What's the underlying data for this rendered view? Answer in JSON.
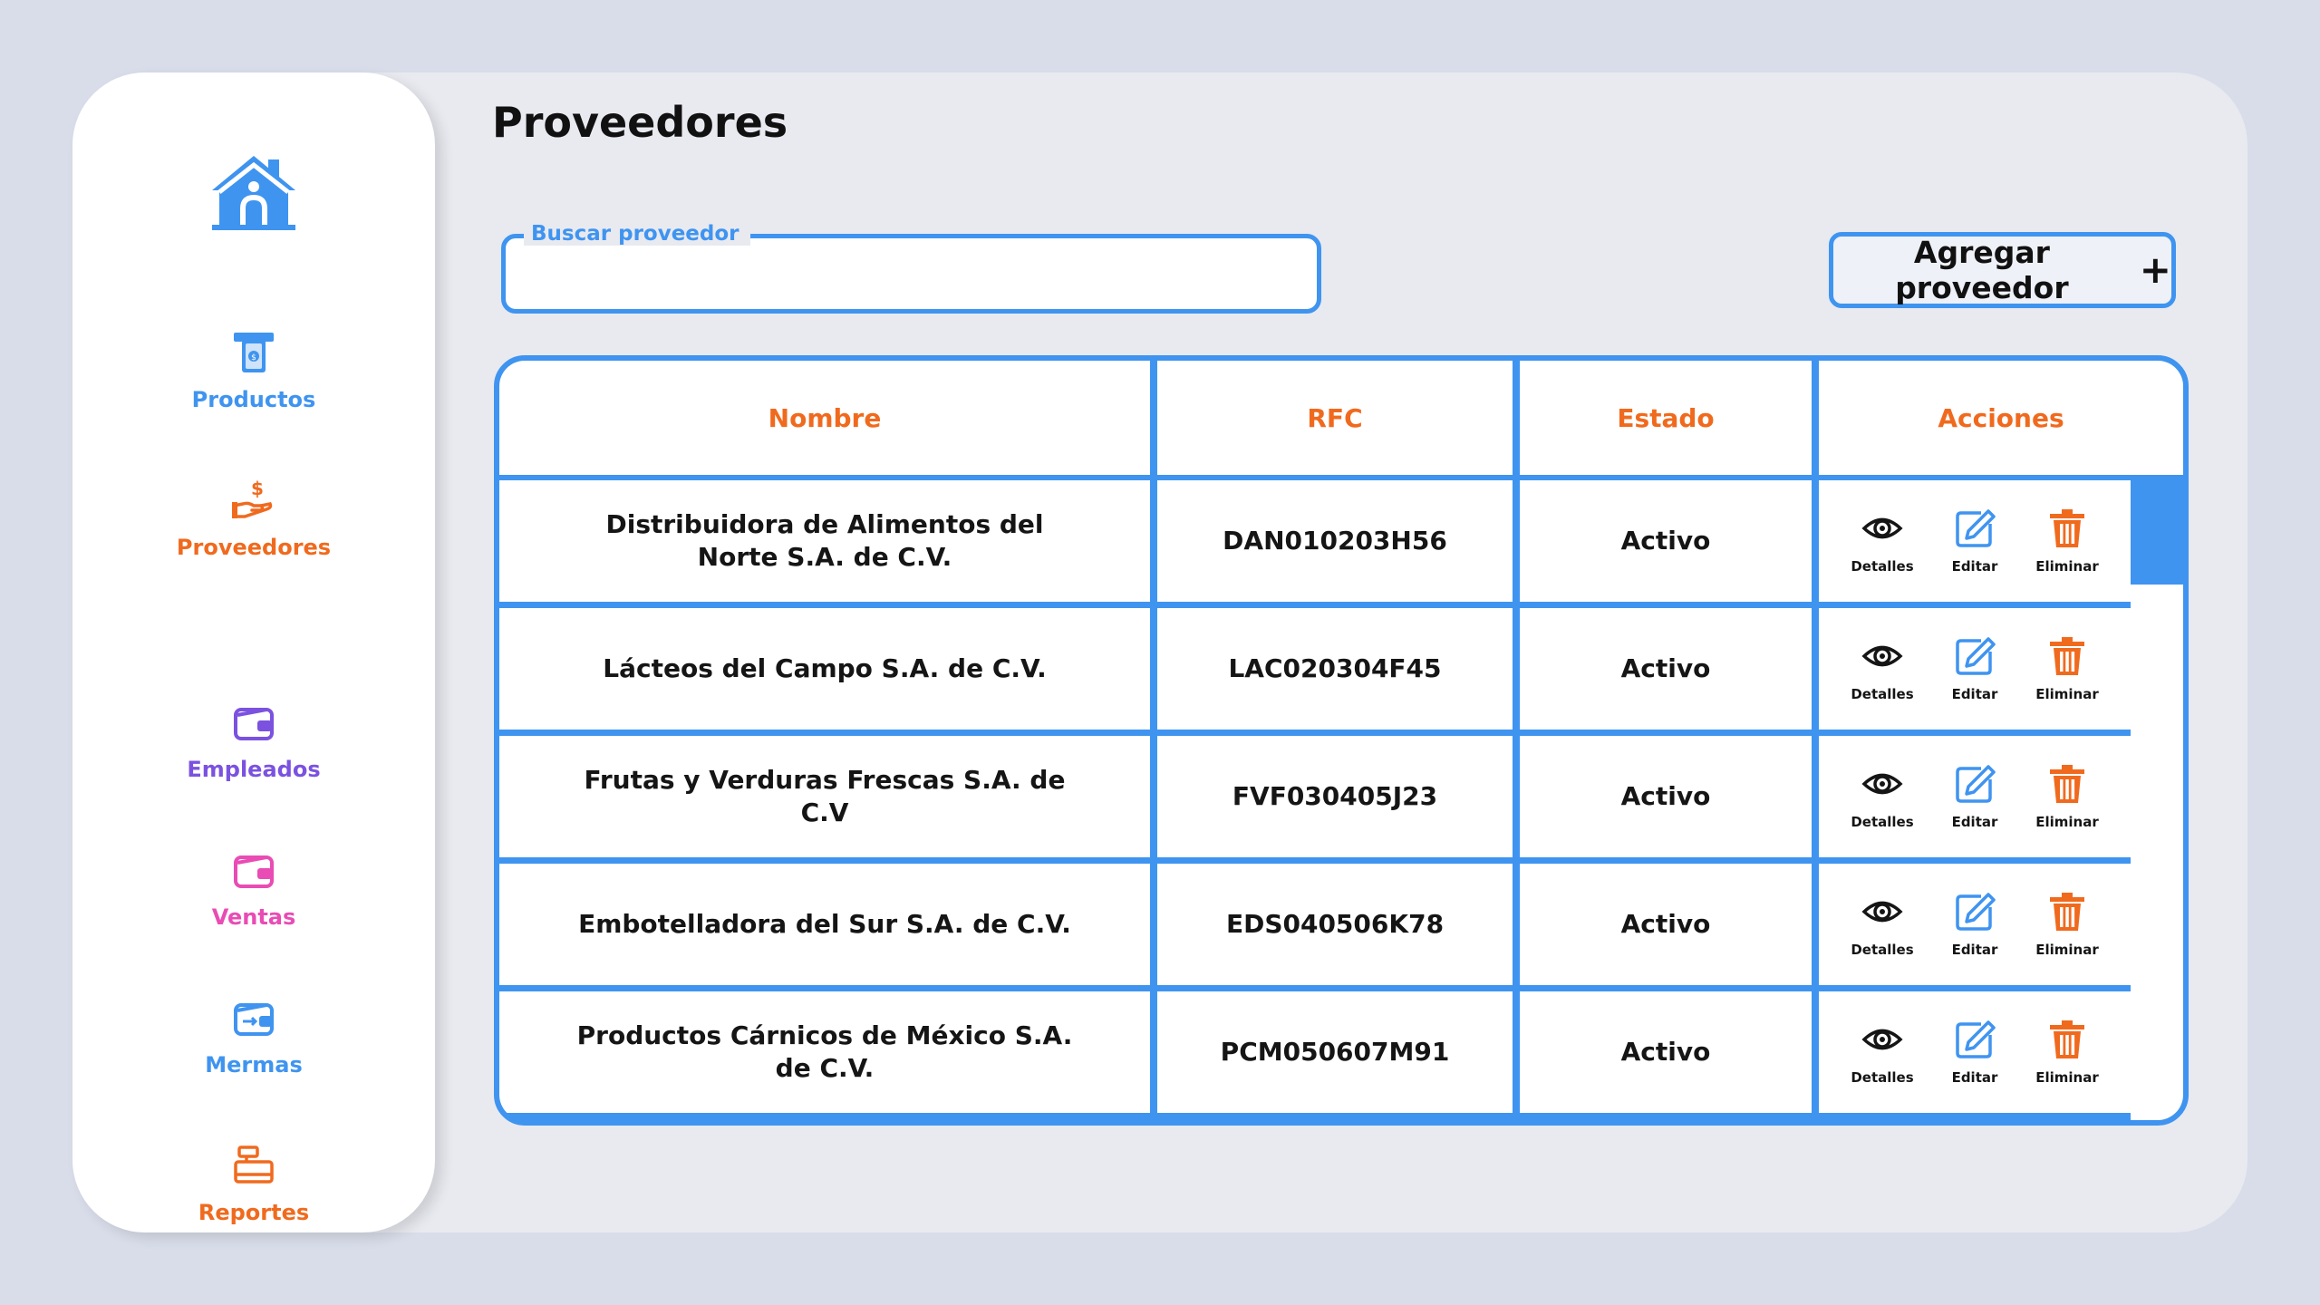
{
  "page": {
    "title": "Proveedores"
  },
  "sidebar": {
    "home_icon": "home-icon",
    "items": [
      {
        "label": "Productos",
        "icon": "atm-cash-icon",
        "color": "#3f94f0"
      },
      {
        "label": "Proveedores",
        "icon": "hand-dollar-icon",
        "color": "#f06a1e"
      },
      {
        "label": "Empleados",
        "icon": "wallet-icon",
        "color": "#7b52e0"
      },
      {
        "label": "Ventas",
        "icon": "wallet-icon",
        "color": "#e94cb4"
      },
      {
        "label": "Mermas",
        "icon": "wallet-transfer-icon",
        "color": "#3f94f0"
      },
      {
        "label": "Reportes",
        "icon": "cash-register-icon",
        "color": "#f06a1e"
      }
    ]
  },
  "search": {
    "label": "Buscar proveedor",
    "value": "",
    "placeholder": ""
  },
  "add_button": {
    "label": "Agregar proveedor",
    "icon": "plus-icon"
  },
  "table": {
    "headers": [
      "Nombre",
      "RFC",
      "Estado",
      "Acciones"
    ],
    "actions": {
      "view": "Detalles",
      "edit": "Editar",
      "delete": "Eliminar"
    },
    "rows": [
      {
        "name": "Distribuidora de Alimentos del Norte S.A. de C.V.",
        "rfc": "DAN010203H56",
        "status": "Activo"
      },
      {
        "name": "Lácteos del Campo S.A. de C.V.",
        "rfc": "LAC020304F45",
        "status": "Activo"
      },
      {
        "name": "Frutas y Verduras Frescas S.A. de C.V",
        "rfc": "FVF030405J23",
        "status": "Activo"
      },
      {
        "name": "Embotelladora del Sur S.A. de C.V.",
        "rfc": "EDS040506K78",
        "status": "Activo"
      },
      {
        "name": "Productos Cárnicos de México S.A. de C.V.",
        "rfc": "PCM050607M91",
        "status": "Activo"
      }
    ]
  },
  "colors": {
    "accent": "#3f94f0",
    "header_text": "#f06a1e",
    "delete": "#f06a1e"
  }
}
